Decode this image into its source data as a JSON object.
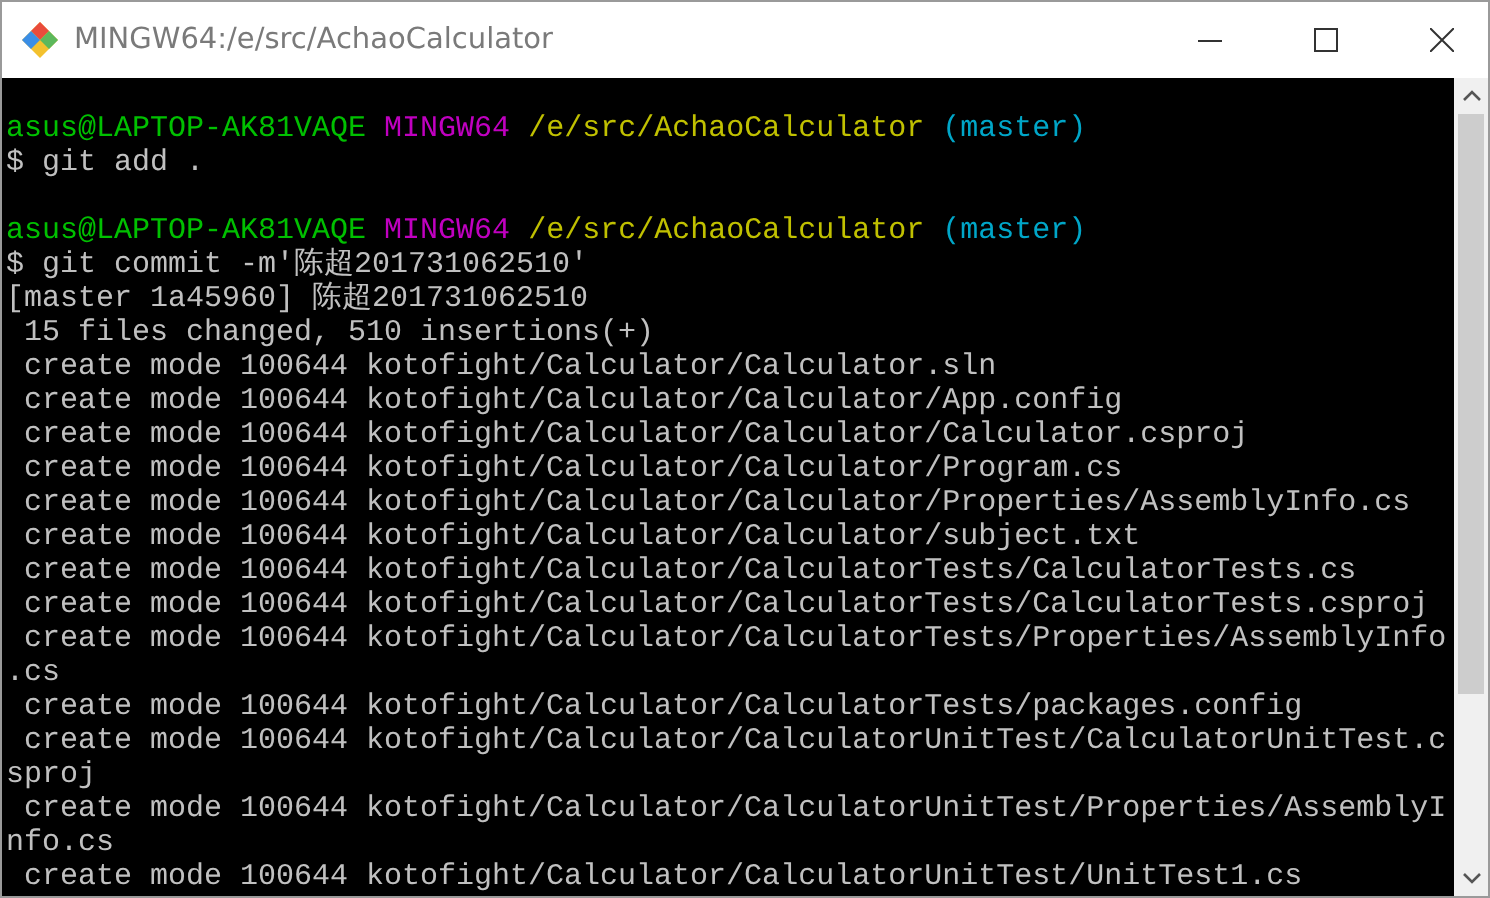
{
  "window": {
    "title": "MINGW64:/e/src/AchaoCalculator"
  },
  "terminal": {
    "lines": [
      {
        "kind": "blank"
      },
      {
        "kind": "prompt",
        "user": "asus@LAPTOP-AK81VAQE",
        "system": "MINGW64",
        "path": "/e/src/AchaoCalculator",
        "branch": "(master)"
      },
      {
        "kind": "output",
        "text": "$ git add ."
      },
      {
        "kind": "blank"
      },
      {
        "kind": "prompt",
        "user": "asus@LAPTOP-AK81VAQE",
        "system": "MINGW64",
        "path": "/e/src/AchaoCalculator",
        "branch": "(master)"
      },
      {
        "kind": "output",
        "text": "$ git commit -m'陈超201731062510'"
      },
      {
        "kind": "output",
        "text": "[master 1a45960] 陈超201731062510"
      },
      {
        "kind": "output",
        "text": " 15 files changed, 510 insertions(+)"
      },
      {
        "kind": "output",
        "text": " create mode 100644 kotofight/Calculator/Calculator.sln"
      },
      {
        "kind": "output",
        "text": " create mode 100644 kotofight/Calculator/Calculator/App.config"
      },
      {
        "kind": "output",
        "text": " create mode 100644 kotofight/Calculator/Calculator/Calculator.csproj"
      },
      {
        "kind": "output",
        "text": " create mode 100644 kotofight/Calculator/Calculator/Program.cs"
      },
      {
        "kind": "output",
        "text": " create mode 100644 kotofight/Calculator/Calculator/Properties/AssemblyInfo.cs"
      },
      {
        "kind": "output",
        "text": " create mode 100644 kotofight/Calculator/Calculator/subject.txt"
      },
      {
        "kind": "output",
        "text": " create mode 100644 kotofight/Calculator/CalculatorTests/CalculatorTests.cs"
      },
      {
        "kind": "output",
        "text": " create mode 100644 kotofight/Calculator/CalculatorTests/CalculatorTests.csproj"
      },
      {
        "kind": "output",
        "text": " create mode 100644 kotofight/Calculator/CalculatorTests/Properties/AssemblyInfo"
      },
      {
        "kind": "output",
        "text": ".cs"
      },
      {
        "kind": "output",
        "text": " create mode 100644 kotofight/Calculator/CalculatorTests/packages.config"
      },
      {
        "kind": "output",
        "text": " create mode 100644 kotofight/Calculator/CalculatorUnitTest/CalculatorUnitTest.c"
      },
      {
        "kind": "output",
        "text": "sproj"
      },
      {
        "kind": "output",
        "text": " create mode 100644 kotofight/Calculator/CalculatorUnitTest/Properties/AssemblyI"
      },
      {
        "kind": "output",
        "text": "nfo.cs"
      },
      {
        "kind": "output",
        "text": " create mode 100644 kotofight/Calculator/CalculatorUnitTest/UnitTest1.cs"
      }
    ]
  }
}
